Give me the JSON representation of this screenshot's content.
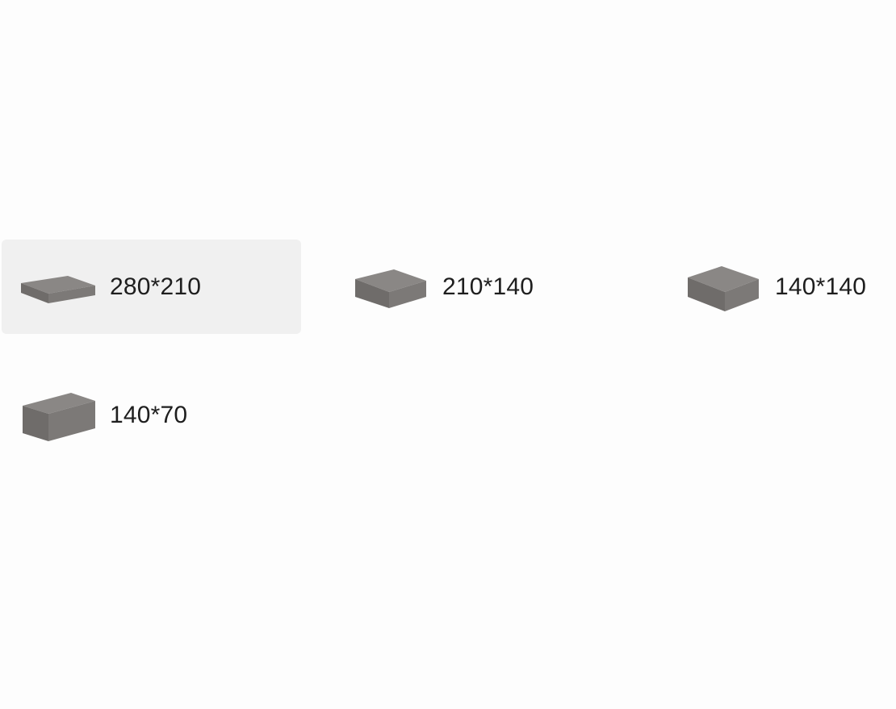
{
  "size_options": [
    {
      "label": "280*210",
      "icon": "paving-stone-280x210-icon",
      "selected": true
    },
    {
      "label": "210*140",
      "icon": "paving-stone-210x140-icon",
      "selected": false
    },
    {
      "label": "140*140",
      "icon": "paving-stone-140x140-icon",
      "selected": false
    },
    {
      "label": "140*70",
      "icon": "paving-stone-140x70-icon",
      "selected": false
    }
  ],
  "colors": {
    "selected_background": "#f0f0f0",
    "stone_top": "#8a8785",
    "stone_front": "#6f6c6a",
    "stone_side": "#7c7977",
    "label_text": "#1e1e1e"
  }
}
